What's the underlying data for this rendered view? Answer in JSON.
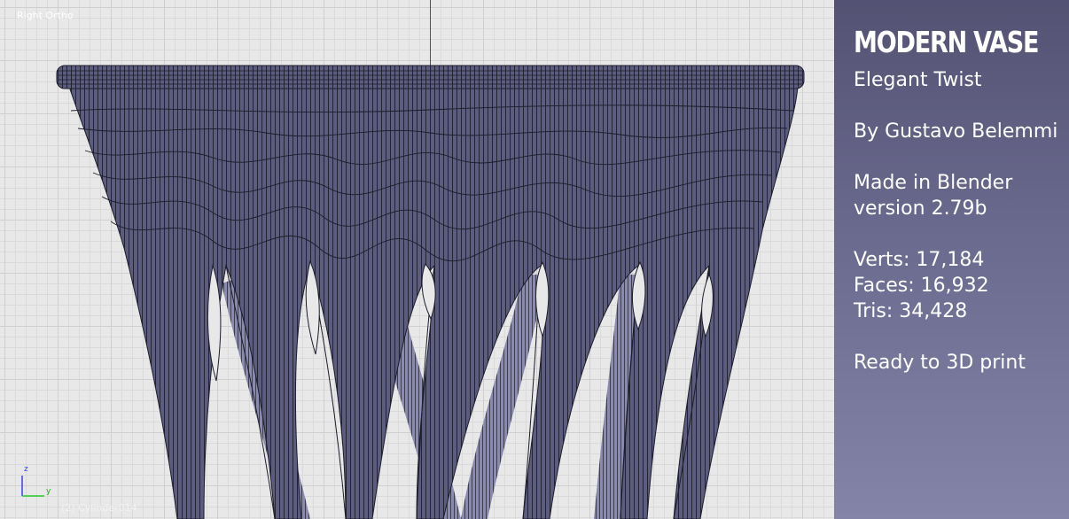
{
  "viewport": {
    "view_name": "Right Ortho",
    "object_name": "(2) Cylinder014",
    "axis_labels": {
      "z": "z",
      "y": "y"
    },
    "colors": {
      "grid_bg": "#e8e8e8",
      "mesh_fill": "#5c5c7e",
      "wire": "#1c1c2a",
      "axis_blue": "#3c3cff",
      "axis_green": "#22cc22"
    }
  },
  "info_panel": {
    "title": "MODERN VASE",
    "subtitle": "Elegant Twist",
    "author": "By Gustavo Belemmi",
    "made_in": "Made in Blender",
    "version": "version 2.79b",
    "verts": "Verts: 17,184",
    "faces": "Faces: 16,932",
    "tris": "Tris: 34,428",
    "ready": "Ready to 3D print"
  }
}
